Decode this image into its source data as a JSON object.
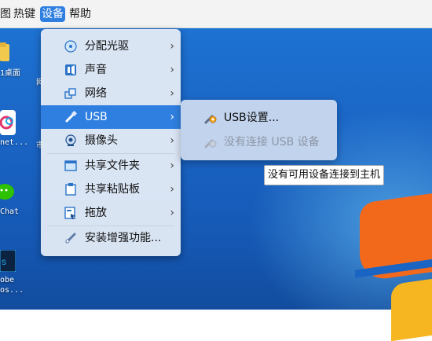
{
  "menubar": {
    "items": [
      "图",
      "热键",
      "设备",
      "帮助"
    ]
  },
  "desktop_labels": {
    "icon1": "1桌面",
    "icon2": "net...",
    "icon3": "Chat",
    "icon4_line1": "obe",
    "icon4_line2": "os...",
    "stray1": "市",
    "stray2": "网"
  },
  "device_menu": {
    "items": [
      {
        "label": "分配光驱",
        "icon": "disc-icon"
      },
      {
        "label": "声音",
        "icon": "audio-icon"
      },
      {
        "label": "网络",
        "icon": "network-icon"
      },
      {
        "label": "USB",
        "icon": "usb-icon"
      },
      {
        "label": "摄像头",
        "icon": "webcam-icon"
      },
      {
        "label": "共享文件夹",
        "icon": "shared-folder-icon"
      },
      {
        "label": "共享粘贴板",
        "icon": "clipboard-icon"
      },
      {
        "label": "拖放",
        "icon": "drag-drop-icon"
      },
      {
        "label": "安装增强功能...",
        "icon": "install-additions-icon"
      }
    ],
    "arrow": "›"
  },
  "usb_submenu": {
    "items": [
      {
        "label": "USB设置..."
      },
      {
        "label": "没有连接 USB 设备"
      }
    ]
  },
  "tooltip": {
    "text": "没有可用设备连接到主机"
  },
  "colors": {
    "accent": "#2f7fe1",
    "desktop": "#1a64c4"
  }
}
